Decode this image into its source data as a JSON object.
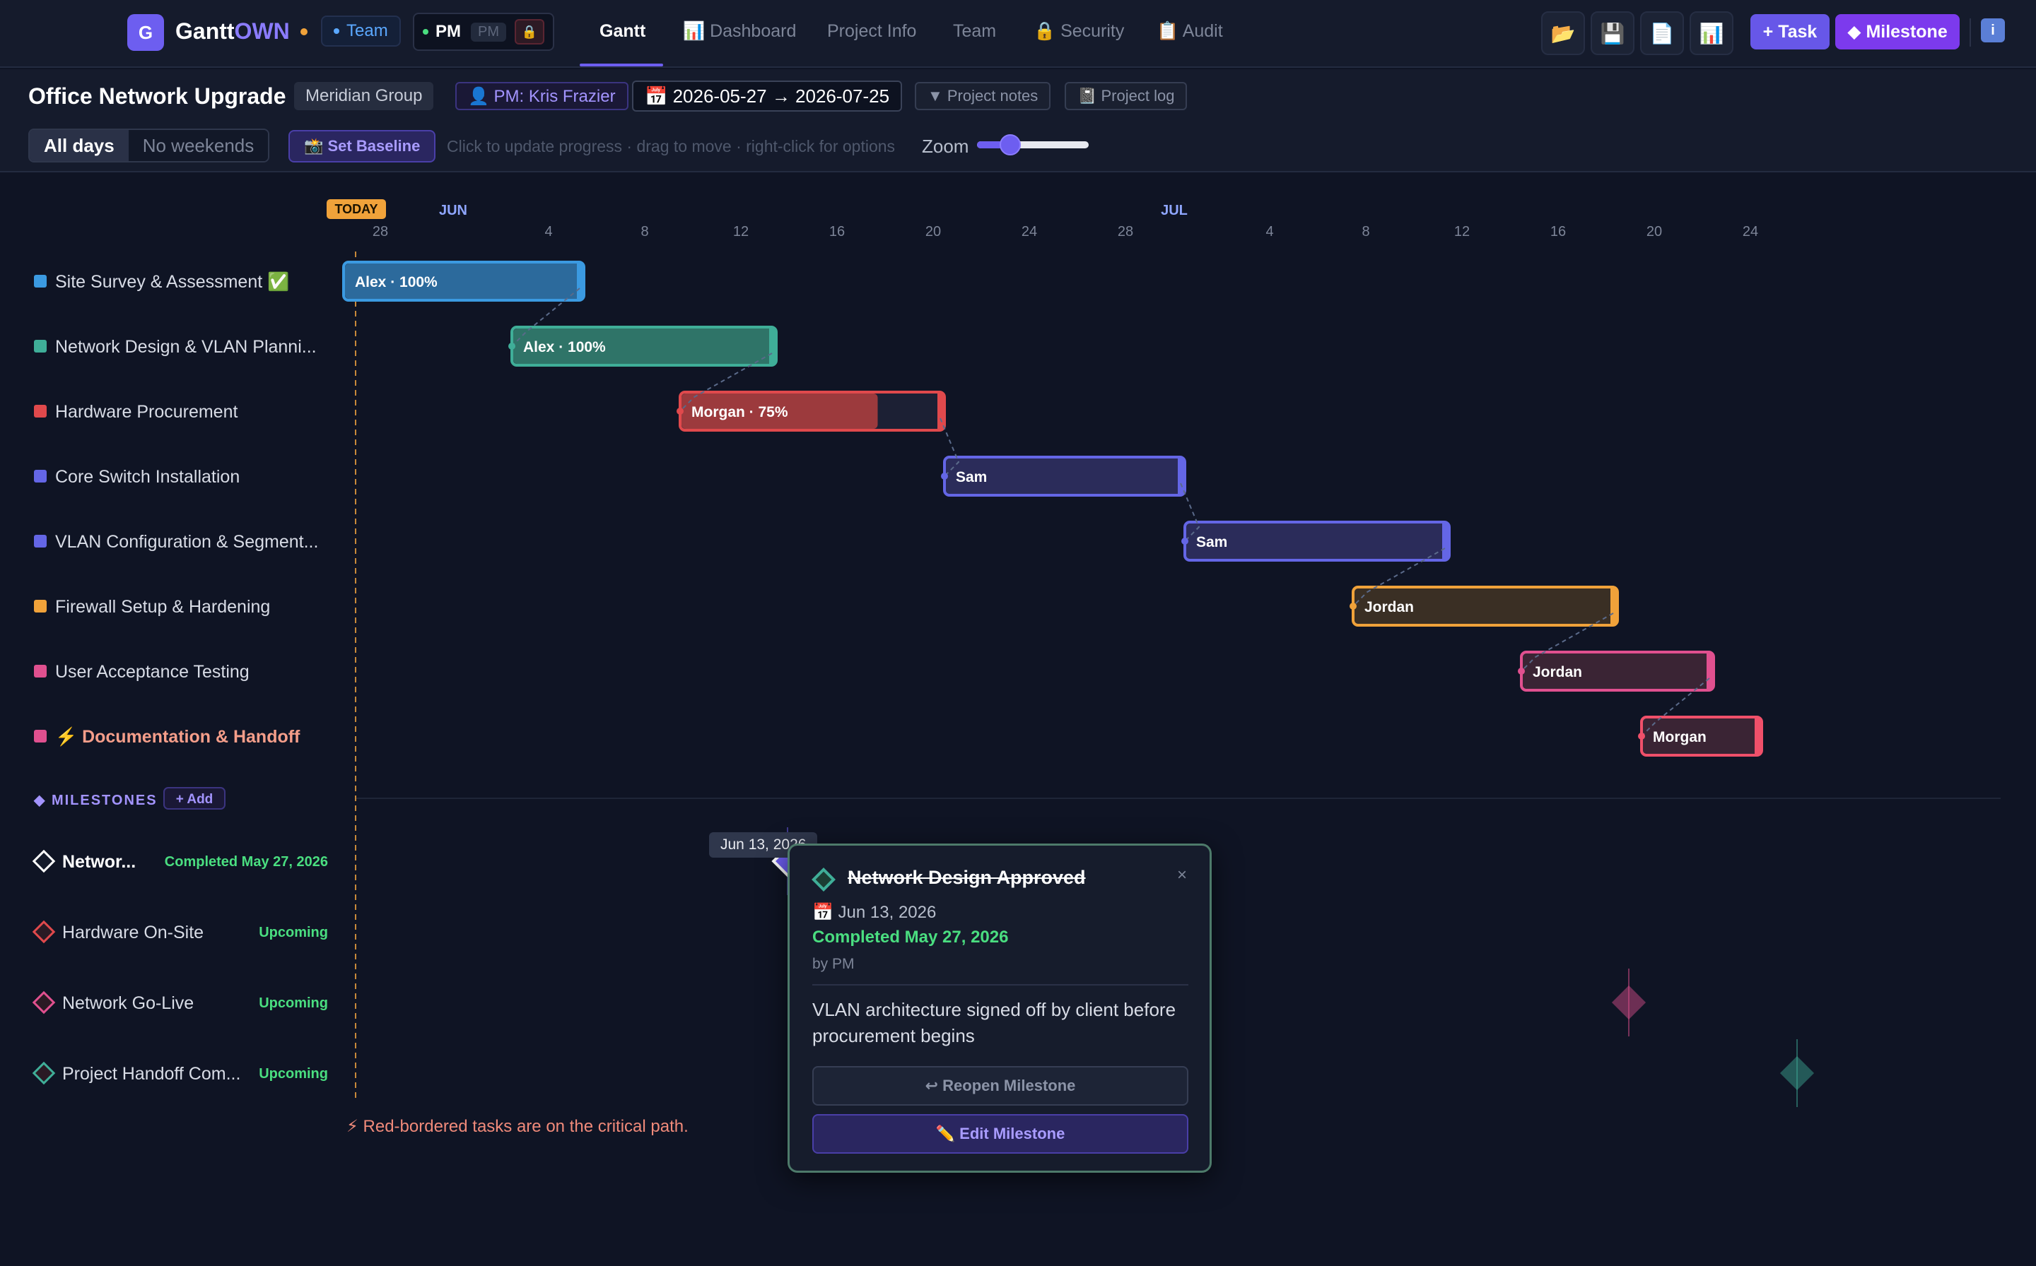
{
  "app": {
    "logo_letter": "G",
    "brand_main": "Gantt",
    "brand_accent": "OWN",
    "team_label": "Team",
    "role_label": "PM",
    "role_sub": "PM",
    "lock_icon": "🔒"
  },
  "nav": {
    "tabs": [
      {
        "label": "Gantt"
      },
      {
        "label": "📊 Dashboard"
      },
      {
        "label": "Project Info"
      },
      {
        "label": "Team"
      },
      {
        "label": "🔒 Security"
      },
      {
        "label": "📋 Audit"
      }
    ]
  },
  "toolbar": {
    "open_icon": "📂",
    "save_icon": "💾",
    "export_icon": "📄",
    "report_icon": "📊",
    "add_task": "+ Task",
    "add_milestone": "◆ Milestone",
    "info_icon": "i"
  },
  "project": {
    "name": "Office Network Upgrade",
    "client": "Meridian Group",
    "pm": "👤 PM: Kris Frazier",
    "dates": "📅 2026-05-27 → 2026-07-25",
    "notes": "▼ Project notes",
    "log": "📓 Project log"
  },
  "controls": {
    "all_days": "All days",
    "no_weekends": "No weekends",
    "set_baseline": "📸 Set Baseline",
    "hint": "Click to update progress · drag to move · right-click for options",
    "zoom_label": "Zoom"
  },
  "timeline": {
    "today_label": "TODAY",
    "months": [
      {
        "label": "JUN",
        "day_index": 4
      },
      {
        "label": "JUL",
        "day_index": 34
      }
    ],
    "start_date": "2026-05-28",
    "ticks": [
      "28",
      "4",
      "8",
      "12",
      "16",
      "20",
      "24",
      "28",
      "4",
      "8",
      "12",
      "16",
      "20",
      "24"
    ],
    "tick_days": [
      0,
      7,
      11,
      15,
      19,
      23,
      27,
      31,
      37,
      41,
      45,
      49,
      53,
      57
    ]
  },
  "tasks": [
    {
      "name": "Site Survey & Assessment ✅",
      "color": "#3b9ae1",
      "bar_label": "Alex · 100%",
      "start": -0.5,
      "end": 9.5,
      "progress": 100,
      "fill": "#2c6a9c",
      "border": "#3b9ae1",
      "critical": false
    },
    {
      "name": "Network Design & VLAN Planni...",
      "color": "#3fae98",
      "bar_label": "Alex · 100%",
      "start": 6.5,
      "end": 17.5,
      "progress": 100,
      "fill": "#2f7468",
      "border": "#3fae98",
      "critical": false
    },
    {
      "name": "Hardware Procurement",
      "color": "#e0494c",
      "bar_label": "Morgan · 75%",
      "start": 13.5,
      "end": 24.5,
      "progress": 75,
      "fill": "#9c3a3d",
      "border": "#e0494c",
      "critical": false
    },
    {
      "name": "Core Switch Installation",
      "color": "#6466e6",
      "bar_label": "Sam",
      "start": 24.5,
      "end": 34.5,
      "progress": 0,
      "fill": "#2b2c5a",
      "border": "#6466e6",
      "critical": false
    },
    {
      "name": "VLAN Configuration & Segment...",
      "color": "#6466e6",
      "bar_label": "Sam",
      "start": 34.5,
      "end": 45.5,
      "progress": 0,
      "fill": "#2b2c5a",
      "border": "#6466e6",
      "critical": false
    },
    {
      "name": "Firewall Setup & Hardening",
      "color": "#f0a23a",
      "bar_label": "Jordan",
      "start": 41.5,
      "end": 52.5,
      "progress": 0,
      "fill": "#3a2f24",
      "border": "#f0a23a",
      "critical": false
    },
    {
      "name": "User Acceptance Testing",
      "color": "#e0508f",
      "bar_label": "Jordan",
      "start": 48.5,
      "end": 56.5,
      "progress": 0,
      "fill": "#3a2434",
      "border": "#e0508f",
      "critical": false
    },
    {
      "name": "⚡ Documentation & Handoff",
      "color": "#e0508f",
      "bar_label": "Morgan",
      "start": 53.5,
      "end": 58.5,
      "progress": 0,
      "fill": "#3a2434",
      "border": "#f0506a",
      "critical": true
    }
  ],
  "milestones_header": {
    "title": "◆ MILESTONES",
    "add": "+ Add"
  },
  "milestones": [
    {
      "name": "Networ...",
      "status": "Completed May 27, 2026",
      "status_color": "#4ade80",
      "color": "#6d5ef0",
      "day": 17,
      "bold": true
    },
    {
      "name": "Hardware On-Site",
      "status": "Upcoming",
      "status_color": "#4ade80",
      "color": "#e0494c",
      "day": null,
      "bold": false
    },
    {
      "name": "Network Go-Live",
      "status": "Upcoming",
      "status_color": "#4ade80",
      "color": "#e0508f",
      "day": 52,
      "bold": false
    },
    {
      "name": "Project Handoff Com...",
      "status": "Upcoming",
      "status_color": "#4ade80",
      "color": "#3fae98",
      "day": 59,
      "bold": false
    }
  ],
  "critical_note": "⚡ Red-bordered tasks are on the critical path.",
  "tooltip": {
    "date": "Jun 13, 2026"
  },
  "popup": {
    "title": "Network Design Approved",
    "date": "📅 Jun 13, 2026",
    "status": "Completed May 27, 2026",
    "by": "by PM",
    "description": "VLAN architecture signed off by client before procurement begins",
    "reopen": "↩ Reopen Milestone",
    "edit": "✏️ Edit Milestone",
    "close": "×"
  }
}
